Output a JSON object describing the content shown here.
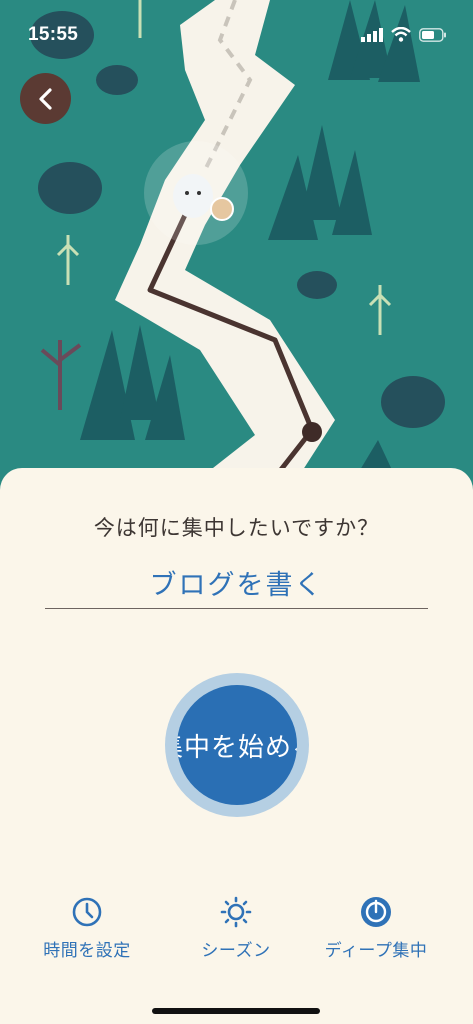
{
  "status_bar": {
    "time": "15:55"
  },
  "question": "今は何に集中したいですか？",
  "task_input": {
    "value": "ブログを書く"
  },
  "start_button": {
    "label": "集中を始める"
  },
  "bottom_nav": [
    {
      "label": "時間を設定",
      "icon": "clock-icon"
    },
    {
      "label": "シーズン",
      "icon": "sun-icon"
    },
    {
      "label": "ディープ集中",
      "icon": "deep-focus-icon"
    }
  ],
  "colors": {
    "map_background": "#2a8a82",
    "sheet_background": "#fbf6ea",
    "accent_blue": "#2f72b7",
    "start_button": "#2a6fb4",
    "start_ring": "#b5cfe3",
    "back_button": "#5b3a33"
  }
}
